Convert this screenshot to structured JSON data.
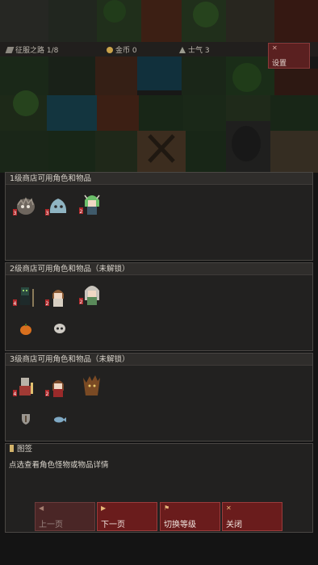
{
  "topbar": {
    "route": "征服之路 1/8",
    "gold": "金币 0",
    "morale": "士气 3",
    "settings_label": "设置"
  },
  "shop_panels": [
    {
      "title": "1级商店可用角色和物品"
    },
    {
      "title": "2级商店可用角色和物品（未解锁）"
    },
    {
      "title": "3级商店可用角色和物品（未解锁）"
    }
  ],
  "bestiary": {
    "title": "图签",
    "hint": "点选查看角色怪物或物品详情"
  },
  "buttons": {
    "prev": "上一页",
    "next": "下一页",
    "switch_level": "切换等级",
    "close": "关闭"
  },
  "colors": {
    "panel_bg": "#222120",
    "button_red": "#6a1c1c",
    "button_border": "#9a3c3c",
    "accent_gold": "#d3b36a"
  }
}
